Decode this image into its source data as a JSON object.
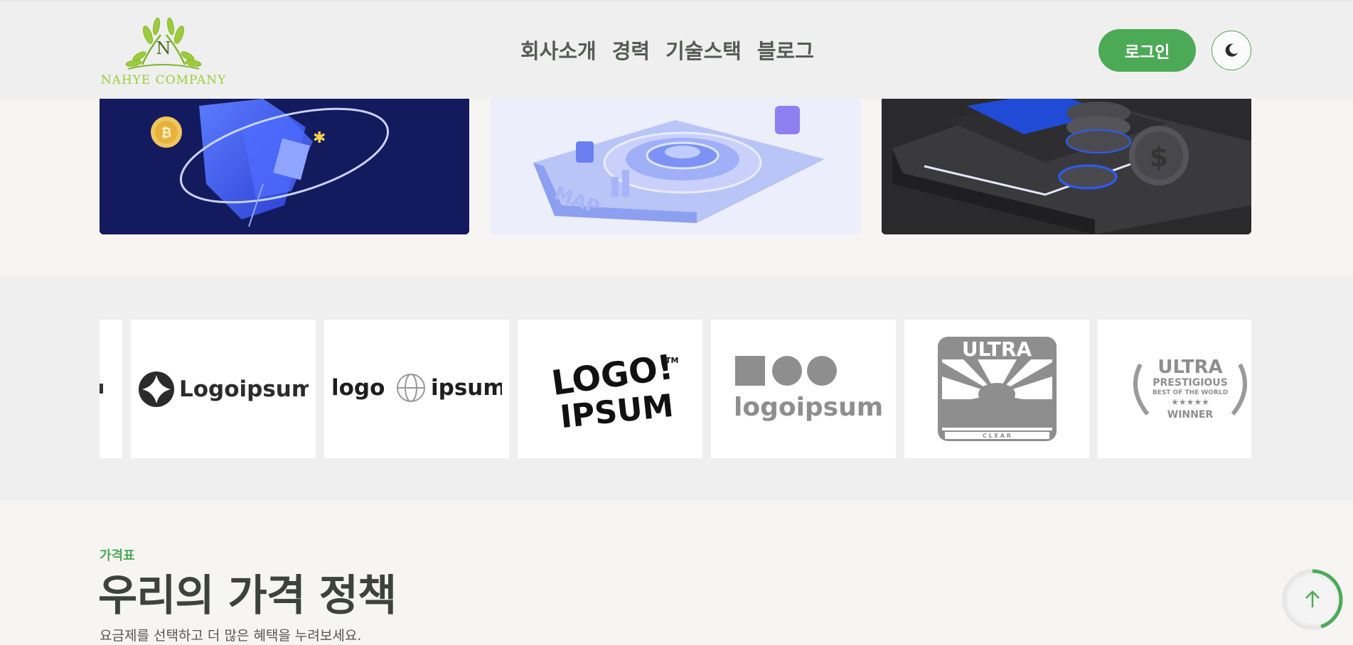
{
  "brand": {
    "logo_text": "NAHYE COMPANY",
    "logo_letter": "N"
  },
  "nav": {
    "items": [
      "회사소개",
      "경력",
      "기술스택",
      "블로그"
    ]
  },
  "header": {
    "login_label": "로그인"
  },
  "clients": {
    "logos": [
      {
        "name": "partial-logo",
        "text": ""
      },
      {
        "name": "logoipsum-star",
        "text": "Logoipsum"
      },
      {
        "name": "logo-globe-ipsum",
        "text_left": "logo",
        "text_right": "ipsum"
      },
      {
        "name": "logo-ipsum-graffiti",
        "text_top": "LOGO!",
        "text_bottom": "IPSUM",
        "mark": "TM"
      },
      {
        "name": "logoipsum-shapes",
        "text": "logoipsum"
      },
      {
        "name": "ultra-clear",
        "text_top": "ULTRA",
        "text_bottom": "C L E A R"
      },
      {
        "name": "ultra-prestigious",
        "line1": "ULTRA",
        "line2": "PRESTIGIOUS",
        "line3": "BEST OF THE WORLD",
        "line4": "★★★★★",
        "line5": "WINNER"
      }
    ]
  },
  "pricing": {
    "eyebrow": "가격표",
    "title": "우리의 가격 정책",
    "subtitle": "요금제를 선택하고 더 많은 혜택을 누려보세요."
  },
  "colors": {
    "accent": "#4caa57",
    "header_bg": "#efefef",
    "page_bg": "#f6f5f3"
  },
  "scroll_progress": 0.45
}
